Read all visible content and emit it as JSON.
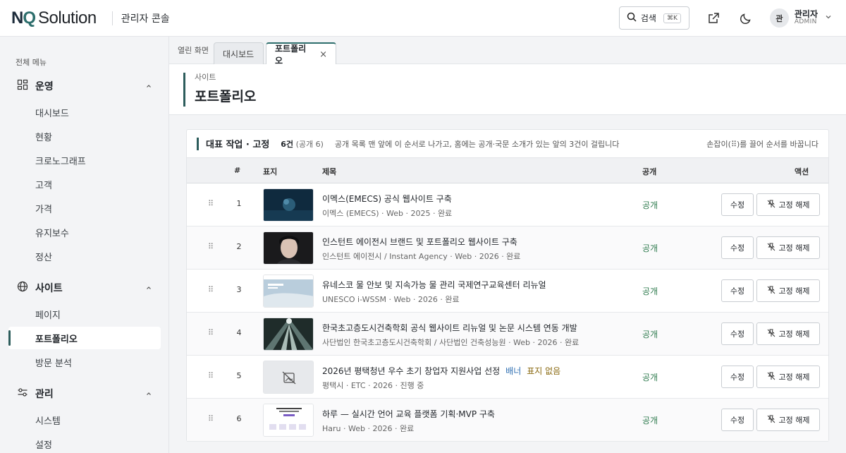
{
  "header": {
    "brand_mark": "NQ",
    "brand_name": "Solution",
    "console_title": "관리자 콘솔",
    "search_label": "검색",
    "search_shortcut": "⌘K",
    "user": {
      "avatar_initial": "관",
      "name": "관리자",
      "role": "ADMIN"
    }
  },
  "sidebar": {
    "caption": "전체 메뉴",
    "groups": [
      {
        "label": "운영",
        "icon": "grid-icon",
        "items": [
          "대시보드",
          "현황",
          "크로노그래프",
          "고객",
          "가격",
          "유지보수",
          "정산"
        ]
      },
      {
        "label": "사이트",
        "icon": "globe-icon",
        "items": [
          "페이지",
          "포트폴리오",
          "방문 분석"
        ]
      },
      {
        "label": "관리",
        "icon": "sliders-icon",
        "items": [
          "시스템",
          "설정"
        ]
      }
    ],
    "active_item": "포트폴리오"
  },
  "tabs": {
    "caption": "열린 화면",
    "items": [
      {
        "label": "대시보드",
        "active": false
      },
      {
        "label": "포트폴리오",
        "active": true,
        "close": "×"
      }
    ]
  },
  "page": {
    "breadcrumb": "사이트",
    "title": "포트폴리오"
  },
  "panel": {
    "title": "대표 작업 · 고정",
    "count": "6건",
    "count_sub": "(공개 6)",
    "description": "공개 목록 맨 앞에 이 순서로 나가고, 홈에는 공개·국문 소개가 있는 앞의 3건이 걸립니다",
    "hint": "손잡이(⠿)를 끌어 순서를 바꿉니다",
    "columns": {
      "num": "#",
      "thumb": "표지",
      "title": "제목",
      "status": "공개",
      "actions": "액션"
    },
    "edit_label": "수정",
    "unpin_label": "고정 해제",
    "drag_handle": "⠿",
    "rows": [
      {
        "num": "1",
        "title": "이멕스(EMECS) 공식 웹사이트 구축",
        "meta": "이멕스 (EMECS) · Web · 2025 · 완료",
        "status": "공개",
        "thumb": "dark-blue"
      },
      {
        "num": "2",
        "title": "인스턴트 에이전시 브랜드 및 포트폴리오 웹사이트 구축",
        "meta": "인스턴트 에이전시 / Instant Agency · Web · 2026 · 완료",
        "status": "공개",
        "thumb": "portrait"
      },
      {
        "num": "3",
        "title": "유네스코 물 안보 및 지속가능 물 관리 국제연구교육센터 리뉴얼",
        "meta": "UNESCO i-WSSM · Web · 2026 · 완료",
        "status": "공개",
        "thumb": "water"
      },
      {
        "num": "4",
        "title": "한국초고층도시건축학회 공식 웹사이트 리뉴얼 및 논문 시스템 연동 개발",
        "meta": "사단법인 한국초고층도시건축학회 / 사단법인 건축성능원 · Web · 2026 · 완료",
        "status": "공개",
        "thumb": "towers"
      },
      {
        "num": "5",
        "title": "2026년 평택청년 우수 초기 창업자 지원사업 선정",
        "badge1": "배너",
        "badge2": "표지 없음",
        "meta": "평택시 · ETC · 2026 · 진행 중",
        "status": "공개",
        "thumb": "none"
      },
      {
        "num": "6",
        "title": "하루 — 실시간 언어 교육 플랫폼 기획·MVP 구축",
        "meta": "Haru · Web · 2026 · 완료",
        "status": "공개",
        "thumb": "doc"
      }
    ]
  },
  "colors": {
    "accent": "#2d5d5c",
    "public": "#2d7a4d",
    "badge_blue": "#2f6fb2",
    "badge_amber": "#8a6a12"
  }
}
